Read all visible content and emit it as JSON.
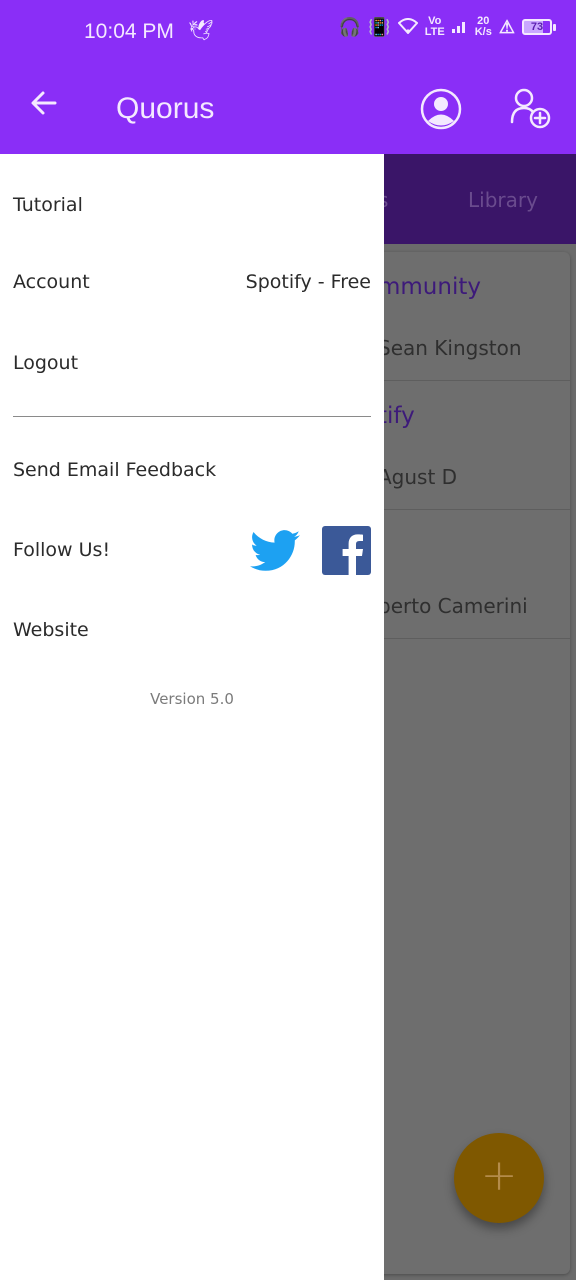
{
  "status_bar": {
    "time": "10:04 PM",
    "network_speed_value": "20",
    "network_speed_unit": "K/s",
    "volte_top": "Vo",
    "volte_bottom": "LTE",
    "battery_level": "73"
  },
  "app_bar": {
    "title": "Quorus",
    "back_icon": "arrow-left-icon",
    "profile_icon": "account-circle-icon",
    "add_user_icon": "person-add-icon"
  },
  "background": {
    "tabs": [
      {
        "label": "s"
      },
      {
        "label": "Library"
      }
    ],
    "rows": [
      {
        "title": "mmunity",
        "subtitle": "Sean Kingston"
      },
      {
        "title": "tify",
        "subtitle": "Agust D"
      },
      {
        "title": "",
        "subtitle": "berto Camerini"
      }
    ],
    "fab_icon": "plus-icon",
    "fab_symbol": "+"
  },
  "drawer": {
    "tutorial": "Tutorial",
    "account_label": "Account",
    "account_value": "Spotify - Free",
    "logout": "Logout",
    "send_feedback": "Send Email Feedback",
    "follow_us": "Follow Us!",
    "website": "Website",
    "version": "Version 5.0"
  },
  "colors": {
    "primary": "#8a2ef7",
    "twitter": "#1da1f2",
    "facebook": "#3b5998",
    "fab": "#7f5800"
  }
}
